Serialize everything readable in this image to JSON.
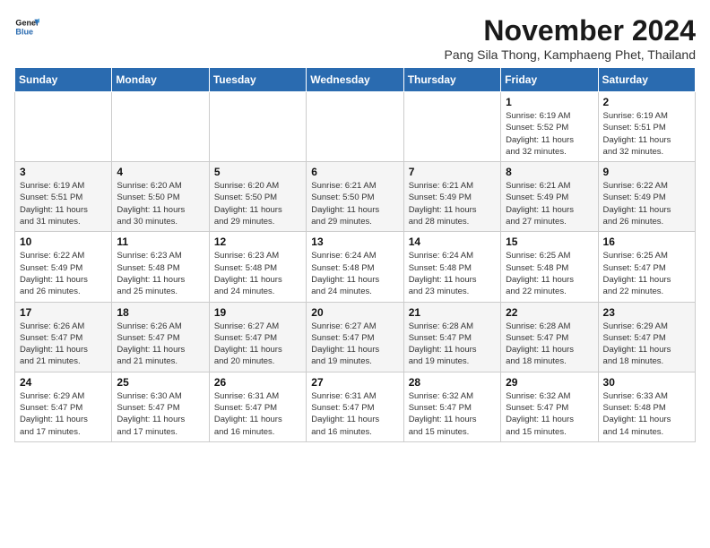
{
  "logo": {
    "line1": "General",
    "line2": "Blue"
  },
  "title": "November 2024",
  "subtitle": "Pang Sila Thong, Kamphaeng Phet, Thailand",
  "weekdays": [
    "Sunday",
    "Monday",
    "Tuesday",
    "Wednesday",
    "Thursday",
    "Friday",
    "Saturday"
  ],
  "weeks": [
    [
      {
        "day": "",
        "info": ""
      },
      {
        "day": "",
        "info": ""
      },
      {
        "day": "",
        "info": ""
      },
      {
        "day": "",
        "info": ""
      },
      {
        "day": "",
        "info": ""
      },
      {
        "day": "1",
        "info": "Sunrise: 6:19 AM\nSunset: 5:52 PM\nDaylight: 11 hours\nand 32 minutes."
      },
      {
        "day": "2",
        "info": "Sunrise: 6:19 AM\nSunset: 5:51 PM\nDaylight: 11 hours\nand 32 minutes."
      }
    ],
    [
      {
        "day": "3",
        "info": "Sunrise: 6:19 AM\nSunset: 5:51 PM\nDaylight: 11 hours\nand 31 minutes."
      },
      {
        "day": "4",
        "info": "Sunrise: 6:20 AM\nSunset: 5:50 PM\nDaylight: 11 hours\nand 30 minutes."
      },
      {
        "day": "5",
        "info": "Sunrise: 6:20 AM\nSunset: 5:50 PM\nDaylight: 11 hours\nand 29 minutes."
      },
      {
        "day": "6",
        "info": "Sunrise: 6:21 AM\nSunset: 5:50 PM\nDaylight: 11 hours\nand 29 minutes."
      },
      {
        "day": "7",
        "info": "Sunrise: 6:21 AM\nSunset: 5:49 PM\nDaylight: 11 hours\nand 28 minutes."
      },
      {
        "day": "8",
        "info": "Sunrise: 6:21 AM\nSunset: 5:49 PM\nDaylight: 11 hours\nand 27 minutes."
      },
      {
        "day": "9",
        "info": "Sunrise: 6:22 AM\nSunset: 5:49 PM\nDaylight: 11 hours\nand 26 minutes."
      }
    ],
    [
      {
        "day": "10",
        "info": "Sunrise: 6:22 AM\nSunset: 5:49 PM\nDaylight: 11 hours\nand 26 minutes."
      },
      {
        "day": "11",
        "info": "Sunrise: 6:23 AM\nSunset: 5:48 PM\nDaylight: 11 hours\nand 25 minutes."
      },
      {
        "day": "12",
        "info": "Sunrise: 6:23 AM\nSunset: 5:48 PM\nDaylight: 11 hours\nand 24 minutes."
      },
      {
        "day": "13",
        "info": "Sunrise: 6:24 AM\nSunset: 5:48 PM\nDaylight: 11 hours\nand 24 minutes."
      },
      {
        "day": "14",
        "info": "Sunrise: 6:24 AM\nSunset: 5:48 PM\nDaylight: 11 hours\nand 23 minutes."
      },
      {
        "day": "15",
        "info": "Sunrise: 6:25 AM\nSunset: 5:48 PM\nDaylight: 11 hours\nand 22 minutes."
      },
      {
        "day": "16",
        "info": "Sunrise: 6:25 AM\nSunset: 5:47 PM\nDaylight: 11 hours\nand 22 minutes."
      }
    ],
    [
      {
        "day": "17",
        "info": "Sunrise: 6:26 AM\nSunset: 5:47 PM\nDaylight: 11 hours\nand 21 minutes."
      },
      {
        "day": "18",
        "info": "Sunrise: 6:26 AM\nSunset: 5:47 PM\nDaylight: 11 hours\nand 21 minutes."
      },
      {
        "day": "19",
        "info": "Sunrise: 6:27 AM\nSunset: 5:47 PM\nDaylight: 11 hours\nand 20 minutes."
      },
      {
        "day": "20",
        "info": "Sunrise: 6:27 AM\nSunset: 5:47 PM\nDaylight: 11 hours\nand 19 minutes."
      },
      {
        "day": "21",
        "info": "Sunrise: 6:28 AM\nSunset: 5:47 PM\nDaylight: 11 hours\nand 19 minutes."
      },
      {
        "day": "22",
        "info": "Sunrise: 6:28 AM\nSunset: 5:47 PM\nDaylight: 11 hours\nand 18 minutes."
      },
      {
        "day": "23",
        "info": "Sunrise: 6:29 AM\nSunset: 5:47 PM\nDaylight: 11 hours\nand 18 minutes."
      }
    ],
    [
      {
        "day": "24",
        "info": "Sunrise: 6:29 AM\nSunset: 5:47 PM\nDaylight: 11 hours\nand 17 minutes."
      },
      {
        "day": "25",
        "info": "Sunrise: 6:30 AM\nSunset: 5:47 PM\nDaylight: 11 hours\nand 17 minutes."
      },
      {
        "day": "26",
        "info": "Sunrise: 6:31 AM\nSunset: 5:47 PM\nDaylight: 11 hours\nand 16 minutes."
      },
      {
        "day": "27",
        "info": "Sunrise: 6:31 AM\nSunset: 5:47 PM\nDaylight: 11 hours\nand 16 minutes."
      },
      {
        "day": "28",
        "info": "Sunrise: 6:32 AM\nSunset: 5:47 PM\nDaylight: 11 hours\nand 15 minutes."
      },
      {
        "day": "29",
        "info": "Sunrise: 6:32 AM\nSunset: 5:47 PM\nDaylight: 11 hours\nand 15 minutes."
      },
      {
        "day": "30",
        "info": "Sunrise: 6:33 AM\nSunset: 5:48 PM\nDaylight: 11 hours\nand 14 minutes."
      }
    ]
  ]
}
